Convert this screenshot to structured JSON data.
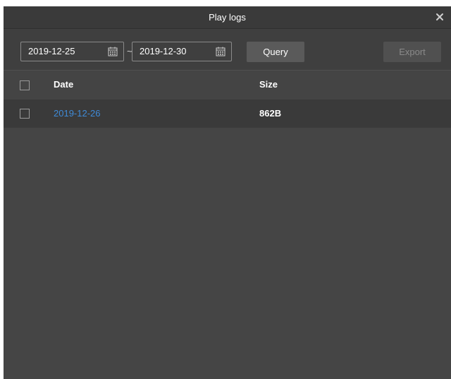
{
  "dialog": {
    "title": "Play logs"
  },
  "toolbar": {
    "start_date": "2019-12-25",
    "end_date": "2019-12-30",
    "separator": "~",
    "query_label": "Query",
    "export_label": "Export"
  },
  "table": {
    "columns": [
      "Date",
      "Size"
    ],
    "rows": [
      {
        "date": "2019-12-26",
        "size": "862B"
      }
    ]
  },
  "colors": {
    "background": "#454545",
    "link": "#3f8bd8",
    "export_disabled_text": "#8a8a8a"
  },
  "icons": [
    "close-icon",
    "calendar-icon",
    "checkbox"
  ]
}
